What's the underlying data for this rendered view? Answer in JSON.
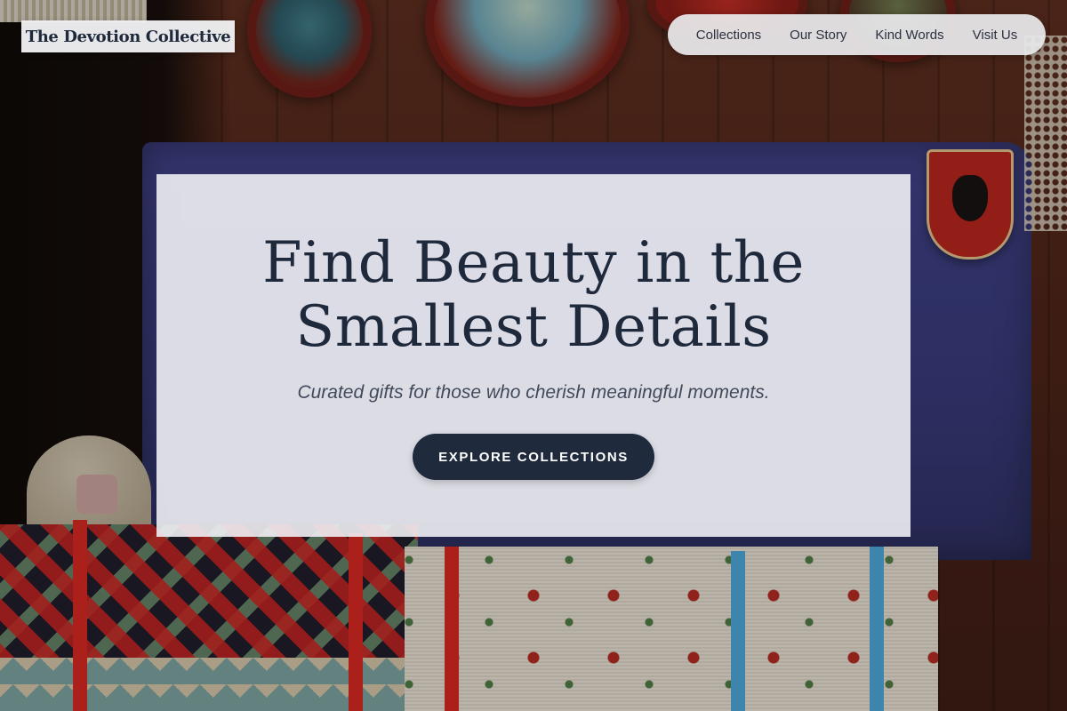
{
  "header": {
    "brand": "The Devotion Collective",
    "nav": [
      {
        "label": "Collections"
      },
      {
        "label": "Our Story"
      },
      {
        "label": "Kind Words"
      },
      {
        "label": "Visit Us"
      }
    ]
  },
  "hero": {
    "title_line_1": "Find Beauty in the",
    "title_line_2": "Smallest Details",
    "subtitle": "Curated gifts for those who cherish meaningful moments.",
    "cta_label": "EXPLORE COLLECTIONS"
  },
  "colors": {
    "primary_text": "#1e293b",
    "cta_background": "#1f2a3c",
    "card_background": "#f0f0f4"
  }
}
